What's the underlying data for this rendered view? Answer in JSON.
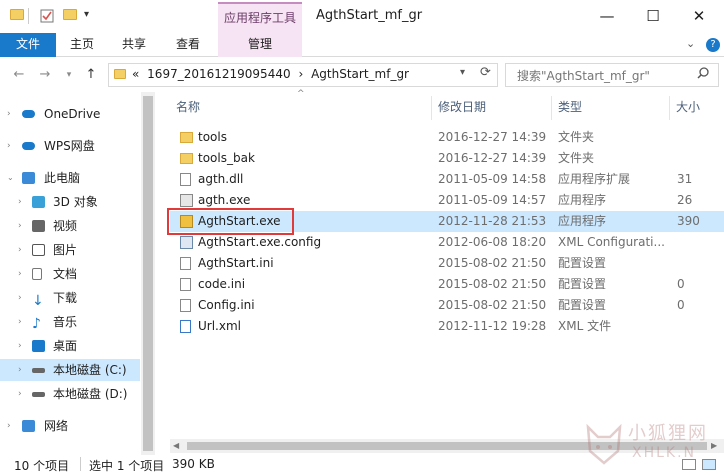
{
  "titlebar": {
    "context_tab": "应用程序工具",
    "title": "AgthStart_mf_gr",
    "minimize": "—",
    "maximize": "☐",
    "close": "✕"
  },
  "ribbon": {
    "tabs": [
      "文件",
      "主页",
      "共享",
      "查看"
    ],
    "manage": "管理",
    "chevron": "⌄",
    "help": "?"
  },
  "address": {
    "prefix": "«",
    "crumbs": [
      "1697_20161219095440",
      "AgthStart_mf_gr"
    ],
    "separator": "›",
    "search_placeholder": "搜索\"AgthStart_mf_gr\""
  },
  "nav": {
    "items": [
      {
        "label": "OneDrive",
        "icon": "cloud-icon",
        "color": "#1979ca"
      },
      {
        "label": "WPS网盘",
        "icon": "cloud-icon",
        "color": "#1979ca"
      },
      {
        "label": "此电脑",
        "icon": "computer-icon",
        "color": "#3a8ad8"
      },
      {
        "label": "3D 对象",
        "icon": "cube-icon",
        "color": "#3aa0d8"
      },
      {
        "label": "视频",
        "icon": "video-icon",
        "color": "#555"
      },
      {
        "label": "图片",
        "icon": "picture-icon",
        "color": "#555"
      },
      {
        "label": "文档",
        "icon": "document-icon",
        "color": "#777"
      },
      {
        "label": "下载",
        "icon": "download-icon",
        "color": "#1979ca"
      },
      {
        "label": "音乐",
        "icon": "music-icon",
        "color": "#1979ca"
      },
      {
        "label": "桌面",
        "icon": "desktop-icon",
        "color": "#1979ca"
      },
      {
        "label": "本地磁盘 (C:)",
        "icon": "drive-icon",
        "color": "#555"
      },
      {
        "label": "本地磁盘 (D:)",
        "icon": "drive-icon",
        "color": "#555"
      },
      {
        "label": "网络",
        "icon": "network-icon",
        "color": "#3a8ad8"
      }
    ]
  },
  "columns": {
    "name": "名称",
    "date": "修改日期",
    "type": "类型",
    "size": "大小"
  },
  "files": [
    {
      "name": "tools",
      "date": "2016-12-27 14:39",
      "type": "文件夹",
      "size": "",
      "icon": "folder-icon"
    },
    {
      "name": "tools_bak",
      "date": "2016-12-27 14:39",
      "type": "文件夹",
      "size": "",
      "icon": "folder-icon"
    },
    {
      "name": "agth.dll",
      "date": "2011-05-09 14:58",
      "type": "应用程序扩展",
      "size": "31",
      "icon": "dll-icon"
    },
    {
      "name": "agth.exe",
      "date": "2011-05-09 14:57",
      "type": "应用程序",
      "size": "26",
      "icon": "exe-icon"
    },
    {
      "name": "AgthStart.exe",
      "date": "2012-11-28 21:53",
      "type": "应用程序",
      "size": "390",
      "icon": "exe-icon"
    },
    {
      "name": "AgthStart.exe.config",
      "date": "2012-06-08 18:20",
      "type": "XML Configurati...",
      "size": "",
      "icon": "config-icon"
    },
    {
      "name": "AgthStart.ini",
      "date": "2015-08-02 21:50",
      "type": "配置设置",
      "size": "",
      "icon": "ini-icon"
    },
    {
      "name": "code.ini",
      "date": "2015-08-02 21:50",
      "type": "配置设置",
      "size": "0",
      "icon": "ini-icon"
    },
    {
      "name": "Config.ini",
      "date": "2015-08-02 21:50",
      "type": "配置设置",
      "size": "0",
      "icon": "ini-icon"
    },
    {
      "name": "Url.xml",
      "date": "2012-11-12 19:28",
      "type": "XML 文件",
      "size": "",
      "icon": "xml-icon"
    }
  ],
  "status": {
    "count": "10 个项目",
    "selected": "选中 1 个项目",
    "size": "390 KB"
  },
  "watermark": {
    "line1": "小狐狸网",
    "line2": "XHLK.N"
  }
}
